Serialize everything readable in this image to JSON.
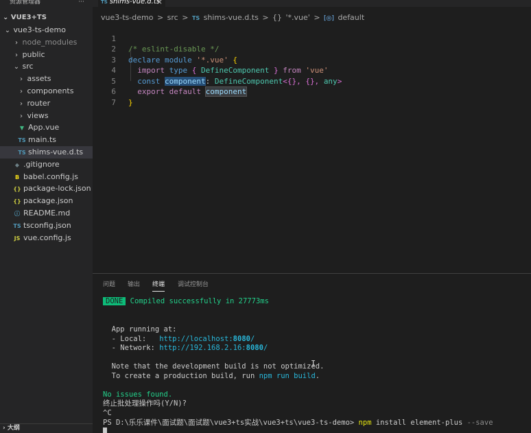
{
  "sidebar": {
    "header": "资源管理器",
    "header_more": "···",
    "root": "VUE3+TS",
    "items": [
      {
        "chev": "⌄",
        "icon": "",
        "label": "vue3-ts-demo",
        "dim": false
      },
      {
        "chev": "›",
        "icon": "",
        "label": "node_modules",
        "dim": true
      },
      {
        "chev": "›",
        "icon": "",
        "label": "public",
        "dim": false
      },
      {
        "chev": "⌄",
        "icon": "",
        "label": "src",
        "dim": false
      },
      {
        "chev": "›",
        "icon": "",
        "label": "assets",
        "dim": false
      },
      {
        "chev": "›",
        "icon": "",
        "label": "components",
        "dim": false
      },
      {
        "chev": "›",
        "icon": "",
        "label": "router",
        "dim": false
      },
      {
        "chev": "›",
        "icon": "",
        "label": "views",
        "dim": false
      },
      {
        "chev": "",
        "icon": "▼",
        "label": "App.vue",
        "dim": false
      },
      {
        "chev": "",
        "icon": "TS",
        "label": "main.ts",
        "dim": false
      },
      {
        "chev": "",
        "icon": "TS",
        "label": "shims-vue.d.ts",
        "dim": false
      },
      {
        "chev": "",
        "icon": "◆",
        "label": ".gitignore",
        "dim": false
      },
      {
        "chev": "",
        "icon": "B",
        "label": "babel.config.js",
        "dim": false
      },
      {
        "chev": "",
        "icon": "{}",
        "label": "package-lock.json",
        "dim": false
      },
      {
        "chev": "",
        "icon": "{}",
        "label": "package.json",
        "dim": false
      },
      {
        "chev": "",
        "icon": "ⓘ",
        "label": "README.md",
        "dim": false
      },
      {
        "chev": "",
        "icon": "TS",
        "label": "tsconfig.json",
        "dim": false
      },
      {
        "chev": "",
        "icon": "JS",
        "label": "vue.config.js",
        "dim": false
      }
    ],
    "outline": "大纲"
  },
  "tab": {
    "icon": "TS",
    "label": "shims-vue.d.ts",
    "close": "×"
  },
  "breadcrumb": {
    "folder": "vue3-ts-demo",
    "sep": ">",
    "src": "src",
    "file_icon": "TS",
    "file": "shims-vue.d.ts",
    "module_icon": "{}",
    "module": "'*.vue'",
    "symbol_icon": "[◎]",
    "symbol": "default"
  },
  "editor": {
    "line_numbers": [
      "1",
      "2",
      "3",
      "4",
      "5",
      "6",
      "7"
    ],
    "line1": "/* eslint-disable */",
    "line2_kw1": "declare",
    "line2_kw2": "module",
    "line2_str": "'*.vue'",
    "line2_brace": "{",
    "line3_kw1": "import",
    "line3_kw2": "type",
    "line3_b1": "{",
    "line3_type": "DefineComponent",
    "line3_b2": "}",
    "line3_from": "from",
    "line3_str": "'vue'",
    "line4_kw": "const",
    "line4_var": "component",
    "line4_colon": ":",
    "line4_type": "DefineComponent",
    "line4_generic": "<{}, {}, ",
    "line4_any": "any",
    "line4_end": ">",
    "line5_kw1": "export",
    "line5_kw2": "default",
    "line5_var": "component",
    "line6": "}"
  },
  "panel": {
    "tabs": [
      "问题",
      "输出",
      "终端",
      "调试控制台"
    ],
    "active_tab": "终端",
    "terminal": {
      "done": "DONE",
      "compiled": "Compiled successfully in 27773ms",
      "app_running": "App running at:",
      "local_label": "- Local:   ",
      "local_url_prefix": "http://localhost:",
      "local_port": "8080",
      "local_url_suffix": "/",
      "network_label": "- Network: ",
      "network_url_prefix": "http://192.168.2.16:",
      "network_port": "8080",
      "network_url_suffix": "/",
      "note": "Note that the development build is not optimized.",
      "create_prefix": "To create a production build, run ",
      "create_cmd": "npm run build",
      "create_suffix": ".",
      "no_issues": "No issues found.",
      "terminate": "终止批处理操作吗(Y/N)?",
      "ctrl_c": "^C",
      "prompt": "PS D:\\乐乐课件\\面试题\\面试题\\vue3+ts实战\\vue3+ts\\vue3-ts-demo> ",
      "cmd_npm": "npm",
      "cmd_rest": " install element-plus ",
      "cmd_flag": "--save"
    }
  }
}
